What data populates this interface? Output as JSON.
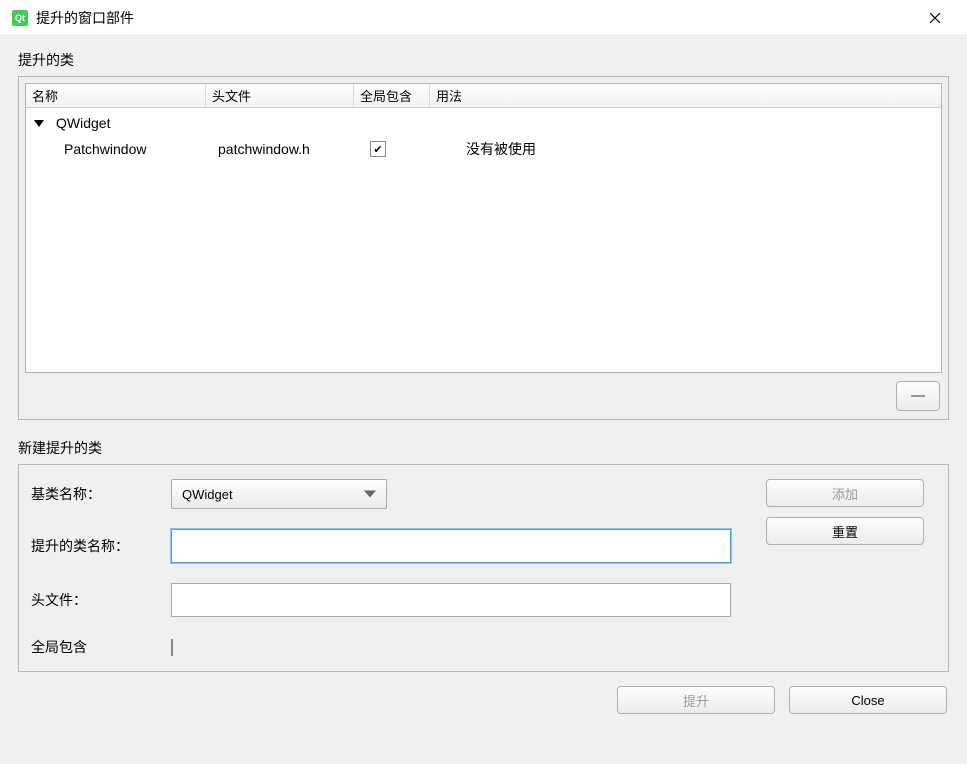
{
  "window": {
    "title": "提升的窗口部件"
  },
  "promoted": {
    "group_label": "提升的类",
    "columns": {
      "name": "名称",
      "header": "头文件",
      "global": "全局包含",
      "usage": "用法"
    },
    "root": {
      "name": "QWidget",
      "expanded": true
    },
    "items": [
      {
        "name": "Patchwindow",
        "header": "patchwindow.h",
        "global_include": true,
        "usage": "没有被使用"
      }
    ]
  },
  "newclass": {
    "group_label": "新建提升的类",
    "labels": {
      "base": "基类名称：",
      "promoted_name": "提升的类名称：",
      "header": "头文件：",
      "global": "全局包含"
    },
    "values": {
      "base": "QWidget",
      "promoted_name": "",
      "header": "",
      "global": false
    },
    "buttons": {
      "add": "添加",
      "reset": "重置"
    }
  },
  "footer": {
    "promote": "提升",
    "close": "Close"
  },
  "checkmark": "✔"
}
